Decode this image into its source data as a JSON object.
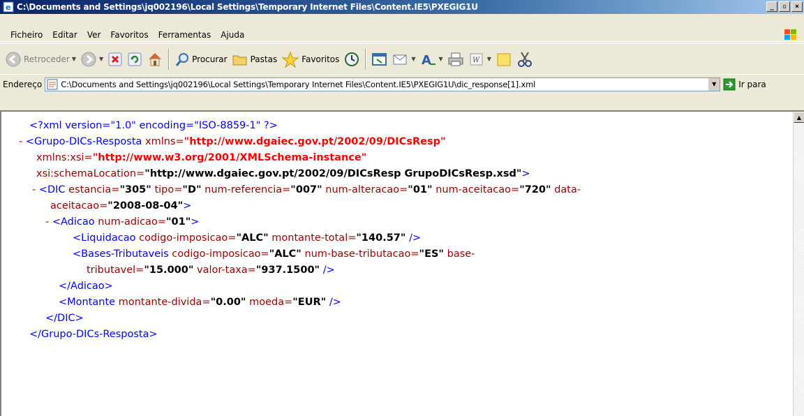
{
  "window": {
    "title": "C:\\Documents and Settings\\jq002196\\Local Settings\\Temporary Internet Files\\Content.IE5\\PXEGIG1U",
    "controls": [
      "_",
      "B",
      "X"
    ]
  },
  "menu": [
    "Ficheiro",
    "Editar",
    "Ver",
    "Favoritos",
    "Ferramentas",
    "Ajuda"
  ],
  "toolbar": {
    "back": "Retroceder",
    "search": "Procurar",
    "folders": "Pastas",
    "favorites": "Favoritos"
  },
  "address": {
    "label": "Endereço",
    "value": "C:\\Documents and Settings\\jq002196\\Local Settings\\Temporary Internet Files\\Content.IE5\\PXEGIG1U\\dic_response[1].xml",
    "go_label": "Ir para"
  },
  "xml": {
    "decl": "<?xml version=\"1.0\" encoding=\"ISO-8859-1\" ?>",
    "minus": "-",
    "root_open": "<Grupo-DICs-Resposta",
    "xmlns_attr": "xmlns=",
    "xmlns_val": "\"http://www.dgaiec.gov.pt/2002/09/DICsResp\"",
    "xsi_attr": "xmlns:xsi=",
    "xsi_val": "\"http://www.w3.org/2001/XMLSchema-instance\"",
    "schema_attr": "xsi:schemaLocation=",
    "schema_val": "\"http://www.dgaiec.gov.pt/2002/09/DICsResp GrupoDICsResp.xsd\"",
    "gt": ">",
    "dic_open": "<DIC",
    "dic_a1": "estancia=",
    "dic_v1": "\"305\"",
    "dic_a2": "tipo=",
    "dic_v2": "\"D\"",
    "dic_a3": "num-referencia=",
    "dic_v3": "\"007\"",
    "dic_a4": "num-alteracao=",
    "dic_v4": "\"01\"",
    "dic_a5": "num-aceitacao=",
    "dic_v5": "\"720\"",
    "dic_a6a": "data-",
    "dic_a6b": "aceitacao=",
    "dic_v6": "\"2008-08-04\"",
    "adicao_open": "<Adicao",
    "adicao_a1": "num-adicao=",
    "adicao_v1": "\"01\"",
    "liq_open": "<Liquidacao",
    "liq_a1": "codigo-imposicao=",
    "liq_v1": "\"ALC\"",
    "liq_a2": "montante-total=",
    "liq_v2": "\"140.57\"",
    "selfclose": "/>",
    "bases_open": "<Bases-Tributaveis",
    "bases_a1": "codigo-imposicao=",
    "bases_v1": "\"ALC\"",
    "bases_a2": "num-base-tributacao=",
    "bases_v2": "\"ES\"",
    "bases_a3a": "base-",
    "bases_a3b": "tributavel=",
    "bases_v3": "\"15.000\"",
    "bases_a4": "valor-taxa=",
    "bases_v4": "\"937.1500\"",
    "adicao_close": "</Adicao>",
    "mont_open": "<Montante",
    "mont_a1": "montante-divida=",
    "mont_v1": "\"0.00\"",
    "mont_a2": "moeda=",
    "mont_v2": "\"EUR\"",
    "dic_close": "</DIC>",
    "root_close": "</Grupo-DICs-Resposta>"
  }
}
